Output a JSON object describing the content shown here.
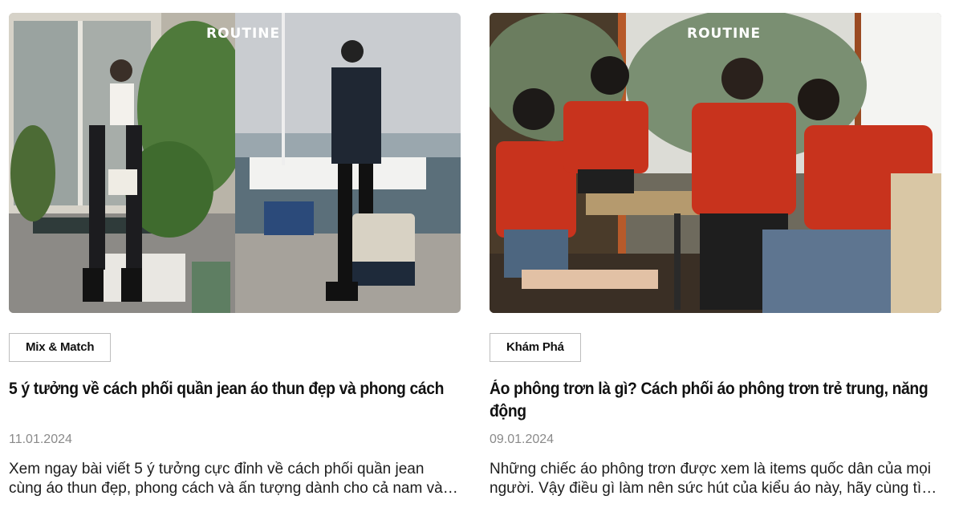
{
  "posts": [
    {
      "brand_logo": "ROUTINE",
      "category": "Mix & Match",
      "title": "5 ý tưởng về cách phối quần jean áo thun đẹp và phong cách",
      "date": "11.01.2024",
      "excerpt": "Xem ngay bài viết 5 ý tưởng cực đỉnh về cách phối quần jean cùng áo thun đẹp, phong cách và ấn tượng dành cho cả nam và nữ",
      "image_subject": "fashion-photo-collage"
    },
    {
      "brand_logo": "ROUTINE",
      "category": "Khám Phá",
      "title": "Áo phông trơn là gì? Cách phối áo phông trơn trẻ trung, năng động",
      "date": "09.01.2024",
      "excerpt": "Những chiếc áo phông trơn được xem là items quốc dân của mọi người. Vậy điều gì làm nên sức hút của kiểu áo này, hãy cùng tìm hiểu",
      "image_subject": "group-in-red-tshirts-photo"
    }
  ],
  "colors": {
    "tag_border": "#bdbdbd",
    "date_text": "#8a8a8a",
    "title_text": "#111111",
    "shirt_red": "#c8331d"
  }
}
